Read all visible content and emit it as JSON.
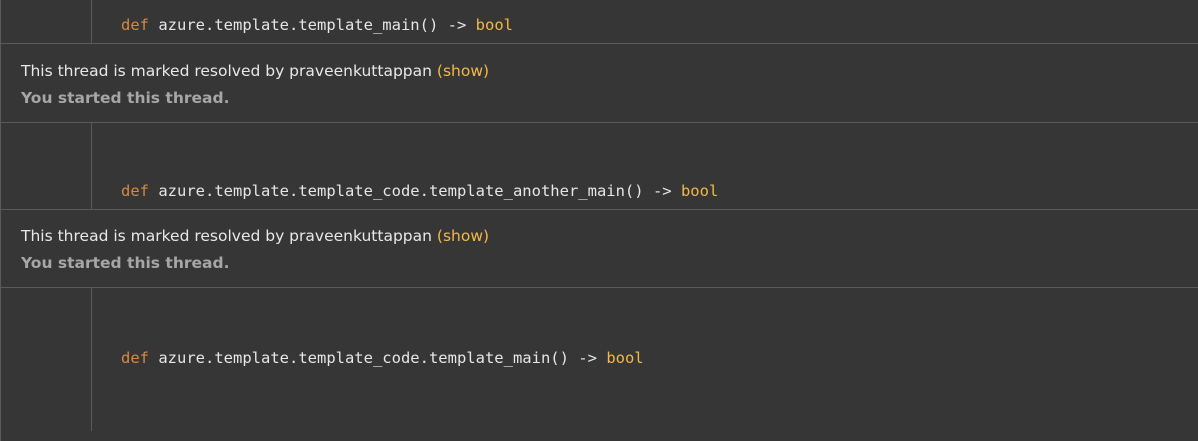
{
  "blocks": [
    {
      "keyword": "def",
      "name": "azure.template.template_main()",
      "arrow": "->",
      "return_type": "bool"
    },
    {
      "keyword": "def",
      "name": "azure.template.template_code.template_another_main()",
      "arrow": "->",
      "return_type": "bool"
    },
    {
      "keyword": "def",
      "name": "azure.template.template_code.template_main()",
      "arrow": "->",
      "return_type": "bool"
    }
  ],
  "threads": [
    {
      "resolved_text": "This thread is marked resolved by praveenkuttappan",
      "show_label": "(show)",
      "started_text": "You started this thread."
    },
    {
      "resolved_text": "This thread is marked resolved by praveenkuttappan",
      "show_label": "(show)",
      "started_text": "You started this thread."
    }
  ],
  "colors": {
    "background": "#363636",
    "keyword": "#d58a3e",
    "return_type": "#f3b845",
    "link": "#f3b845",
    "muted": "#a6a6a6"
  }
}
